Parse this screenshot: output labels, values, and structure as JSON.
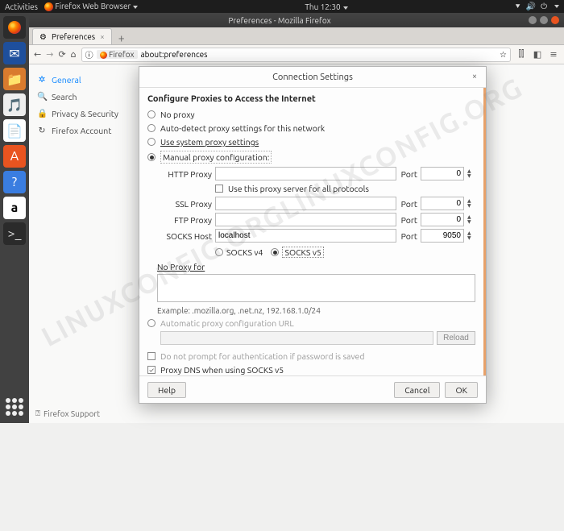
{
  "panel": {
    "activities": "Activities",
    "appmenu": "Firefox Web Browser",
    "clock": "Thu 12:30"
  },
  "window": {
    "title": "Preferences - Mozilla Firefox"
  },
  "tab": {
    "label": "Preferences"
  },
  "urlbar": {
    "badge": "Firefox",
    "url": "about:preferences"
  },
  "prefs": {
    "general": "General",
    "search": "Search",
    "privacy": "Privacy & Security",
    "fxaccount": "Firefox Account",
    "support": "Firefox Support"
  },
  "dialog": {
    "title": "Connection Settings",
    "heading": "Configure Proxies to Access the Internet",
    "no_proxy": "No proxy",
    "auto_detect": "Auto-detect proxy settings for this network",
    "use_system": "Use system proxy settings",
    "manual": "Manual proxy configuration:",
    "http_label": "HTTP Proxy",
    "http_val": "",
    "http_port": "0",
    "share": "Use this proxy server for all protocols",
    "ssl_label": "SSL Proxy",
    "ssl_val": "",
    "ssl_port": "0",
    "ftp_label": "FTP Proxy",
    "ftp_val": "",
    "ftp_port": "0",
    "socks_label": "SOCKS Host",
    "socks_val": "localhost",
    "socks_port": "9050",
    "socks4": "SOCKS v4",
    "socks5": "SOCKS v5",
    "no_proxy_for": "No Proxy for",
    "example": "Example: .mozilla.org, .net.nz, 192.168.1.0/24",
    "pac": "Automatic proxy configuration URL",
    "reload": "Reload",
    "noprompt": "Do not prompt for authentication if password is saved",
    "proxydns": "Proxy DNS when using SOCKS v5",
    "port_label": "Port",
    "help": "Help",
    "cancel": "Cancel",
    "ok": "OK"
  },
  "watermark": "LINUXCONFIG.ORG"
}
